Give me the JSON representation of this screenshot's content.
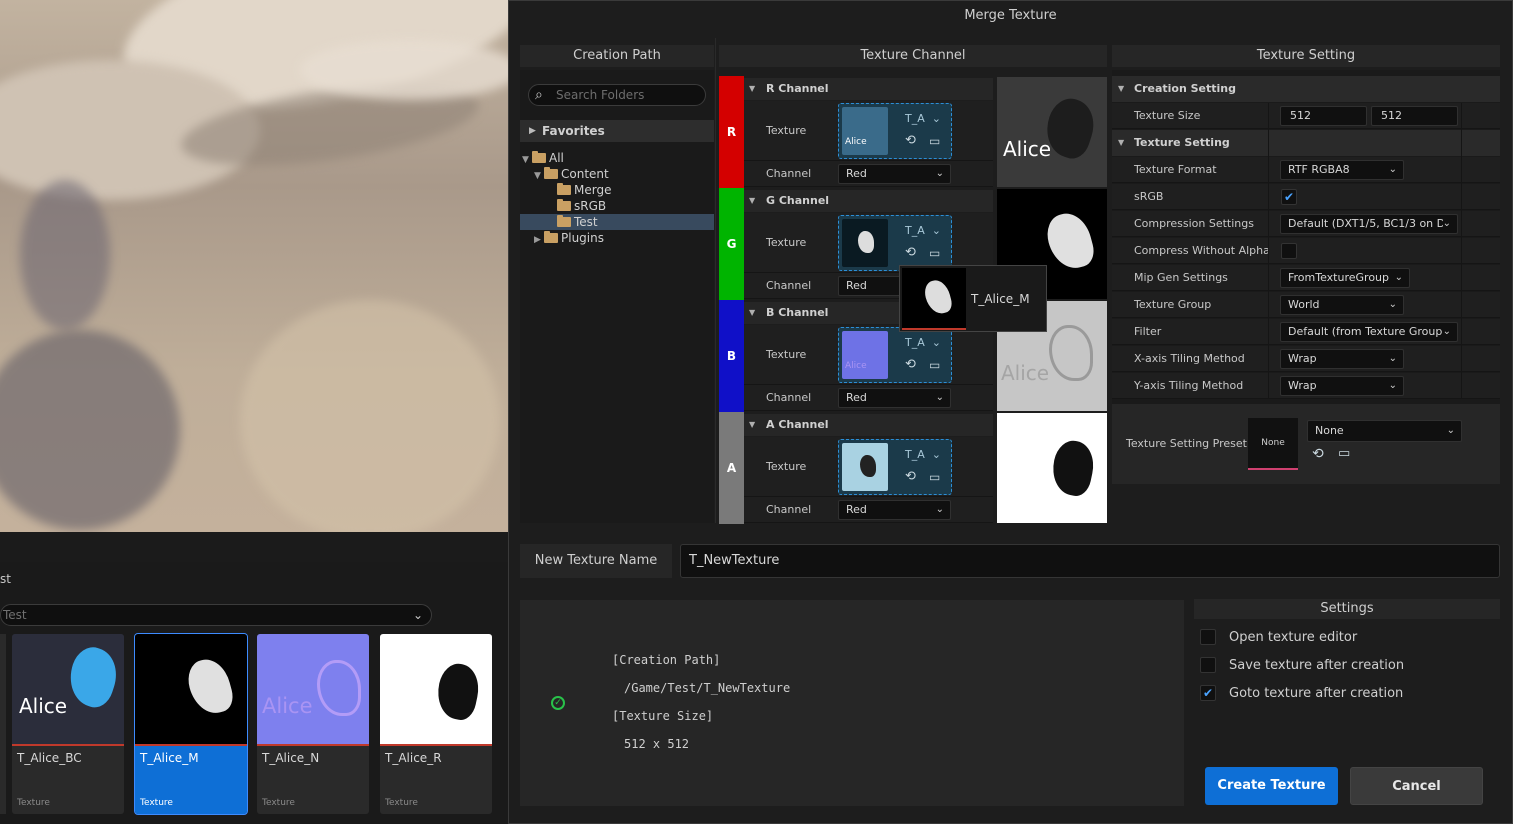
{
  "content_browser": {
    "folder_title": "st",
    "search_text": "Test",
    "assets": [
      {
        "name": "T_Alice_BC",
        "type": "Texture",
        "thumb_text": "Alice"
      },
      {
        "name": "T_Alice_M",
        "type": "Texture",
        "thumb_text": ""
      },
      {
        "name": "T_Alice_N",
        "type": "Texture",
        "thumb_text": "Alice"
      },
      {
        "name": "T_Alice_R",
        "type": "Texture",
        "thumb_text": ""
      }
    ]
  },
  "dialog": {
    "title": "Merge Texture",
    "columns": {
      "creation_path": "Creation Path",
      "texture_channel": "Texture Channel",
      "texture_setting": "Texture Setting"
    }
  },
  "creation_path": {
    "search_placeholder": "Search Folders",
    "favorites": "Favorites",
    "tree": [
      "All",
      "Content",
      "Merge",
      "sRGB",
      "Test",
      "Plugins"
    ],
    "selected": "Test"
  },
  "channels": [
    {
      "letter": "R",
      "header": "R Channel",
      "texture_label": "Texture",
      "texture_name": "T_A",
      "channel_label": "Channel",
      "channel_value": "Red",
      "color": "#d40000",
      "thumb_text": "Alice",
      "preview_text": "Alice"
    },
    {
      "letter": "G",
      "header": "G Channel",
      "texture_label": "Texture",
      "texture_name": "T_A",
      "channel_label": "Channel",
      "channel_value": "Red",
      "color": "#00b400",
      "thumb_text": "",
      "preview_text": ""
    },
    {
      "letter": "B",
      "header": "B Channel",
      "texture_label": "Texture",
      "texture_name": "T_A",
      "channel_label": "Channel",
      "channel_value": "Red",
      "color": "#1010c8",
      "thumb_text": "Alice",
      "preview_text": "Alice"
    },
    {
      "letter": "A",
      "header": "A Channel",
      "texture_label": "Texture",
      "texture_name": "T_A",
      "channel_label": "Channel",
      "channel_value": "Red",
      "color": "#7a7a7a",
      "thumb_text": "",
      "preview_text": ""
    }
  ],
  "tooltip": {
    "name": "T_Alice_M"
  },
  "texture_setting": {
    "creation_section": "Creation Setting",
    "texture_size_label": "Texture Size",
    "width": "512",
    "height": "512",
    "texture_section": "Texture Setting",
    "rows": {
      "format_label": "Texture Format",
      "format_value": "RTF RGBA8",
      "srgb_label": "sRGB",
      "srgb_checked": "✔",
      "compression_label": "Compression Settings",
      "compression_value": "Default (DXT1/5, BC1/3 on D",
      "compress_alpha_label": "Compress Without Alpha",
      "compress_alpha_checked": "",
      "mip_label": "Mip Gen Settings",
      "mip_value": "FromTextureGroup",
      "group_label": "Texture Group",
      "group_value": "World",
      "filter_label": "Filter",
      "filter_value": "Default (from Texture Group)",
      "xtile_label": "X-axis Tiling Method",
      "xtile_value": "Wrap",
      "ytile_label": "Y-axis Tiling Method",
      "ytile_value": "Wrap"
    },
    "preset_label": "Texture Setting Preset",
    "preset_thumb": "None",
    "preset_value": "None"
  },
  "new_texture": {
    "label": "New Texture Name",
    "value": "T_NewTexture"
  },
  "summary": {
    "line1": "[Creation Path]",
    "line2": "/Game/Test/T_NewTexture",
    "line3": "[Texture Size]",
    "line4": "512 x 512"
  },
  "settings": {
    "title": "Settings",
    "items": [
      {
        "label": "Open texture editor",
        "checked": ""
      },
      {
        "label": "Save texture after creation",
        "checked": ""
      },
      {
        "label": "Goto texture after creation",
        "checked": "✔"
      }
    ]
  },
  "buttons": {
    "create": "Create Texture",
    "cancel": "Cancel"
  },
  "colors": {
    "accent": "#0e6fd6",
    "valid": "#29c24a"
  }
}
